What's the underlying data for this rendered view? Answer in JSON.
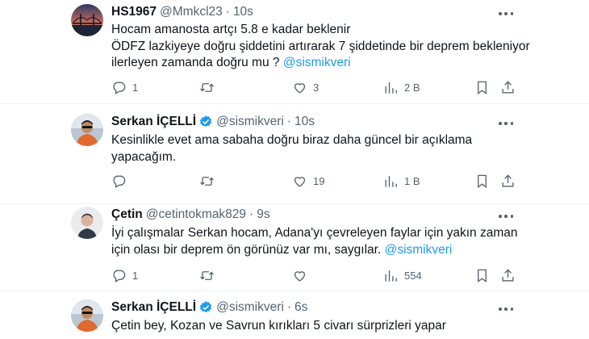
{
  "tweets": [
    {
      "name": "HS1967",
      "handle": "@Mmkcl23",
      "time": "10s",
      "lines": [
        "Hocam amanosta artçı 5.8 e kadar beklenir",
        "ÖDFZ lazkiyeye doğru şiddetini artırarak 7 şiddetinde bir deprem bekleniyor",
        "ilerleyen zamanda doğru mu ?"
      ],
      "mention": "@sismikveri",
      "replies": "1",
      "retweets": "",
      "likes": "3",
      "views": "2 B"
    },
    {
      "name": "Serkan İÇELLİ",
      "handle": "@sismikveri",
      "time": "10s",
      "lines": [
        "Kesinlikle evet ama sabaha doğru biraz daha güncel bir açıklama",
        "yapacağım."
      ],
      "replies": "",
      "retweets": "",
      "likes": "19",
      "views": "1 B"
    },
    {
      "name": "Çetin",
      "handle": "@cetintokmak829",
      "time": "9s",
      "lines": [
        "İyi çalışmalar Serkan hocam, Adana'yı çevreleyen faylar için yakın zaman",
        "için olası bir deprem ön görünüz var mı, saygılar."
      ],
      "mention": "@sismikveri",
      "replies": "1",
      "retweets": "",
      "likes": "",
      "views": "554"
    },
    {
      "name": "Serkan İÇELLİ",
      "handle": "@sismikveri",
      "time": "6s",
      "lines": [
        "Çetin bey, Kozan ve Savrun kırıkları 5 civarı sürprizleri yapar"
      ]
    }
  ],
  "separator": "·",
  "colors": {
    "link": "#1d9bf0",
    "muted": "#536471",
    "text": "#0f1419",
    "divider": "#eff3f4",
    "verified": "#1d9bf0"
  },
  "icons": {
    "reply": "reply-icon",
    "retweet": "retweet-icon",
    "like": "heart-icon",
    "views": "views-icon",
    "bookmark": "bookmark-icon",
    "share": "share-icon",
    "more": "more-icon",
    "verified": "verified-badge-icon"
  }
}
